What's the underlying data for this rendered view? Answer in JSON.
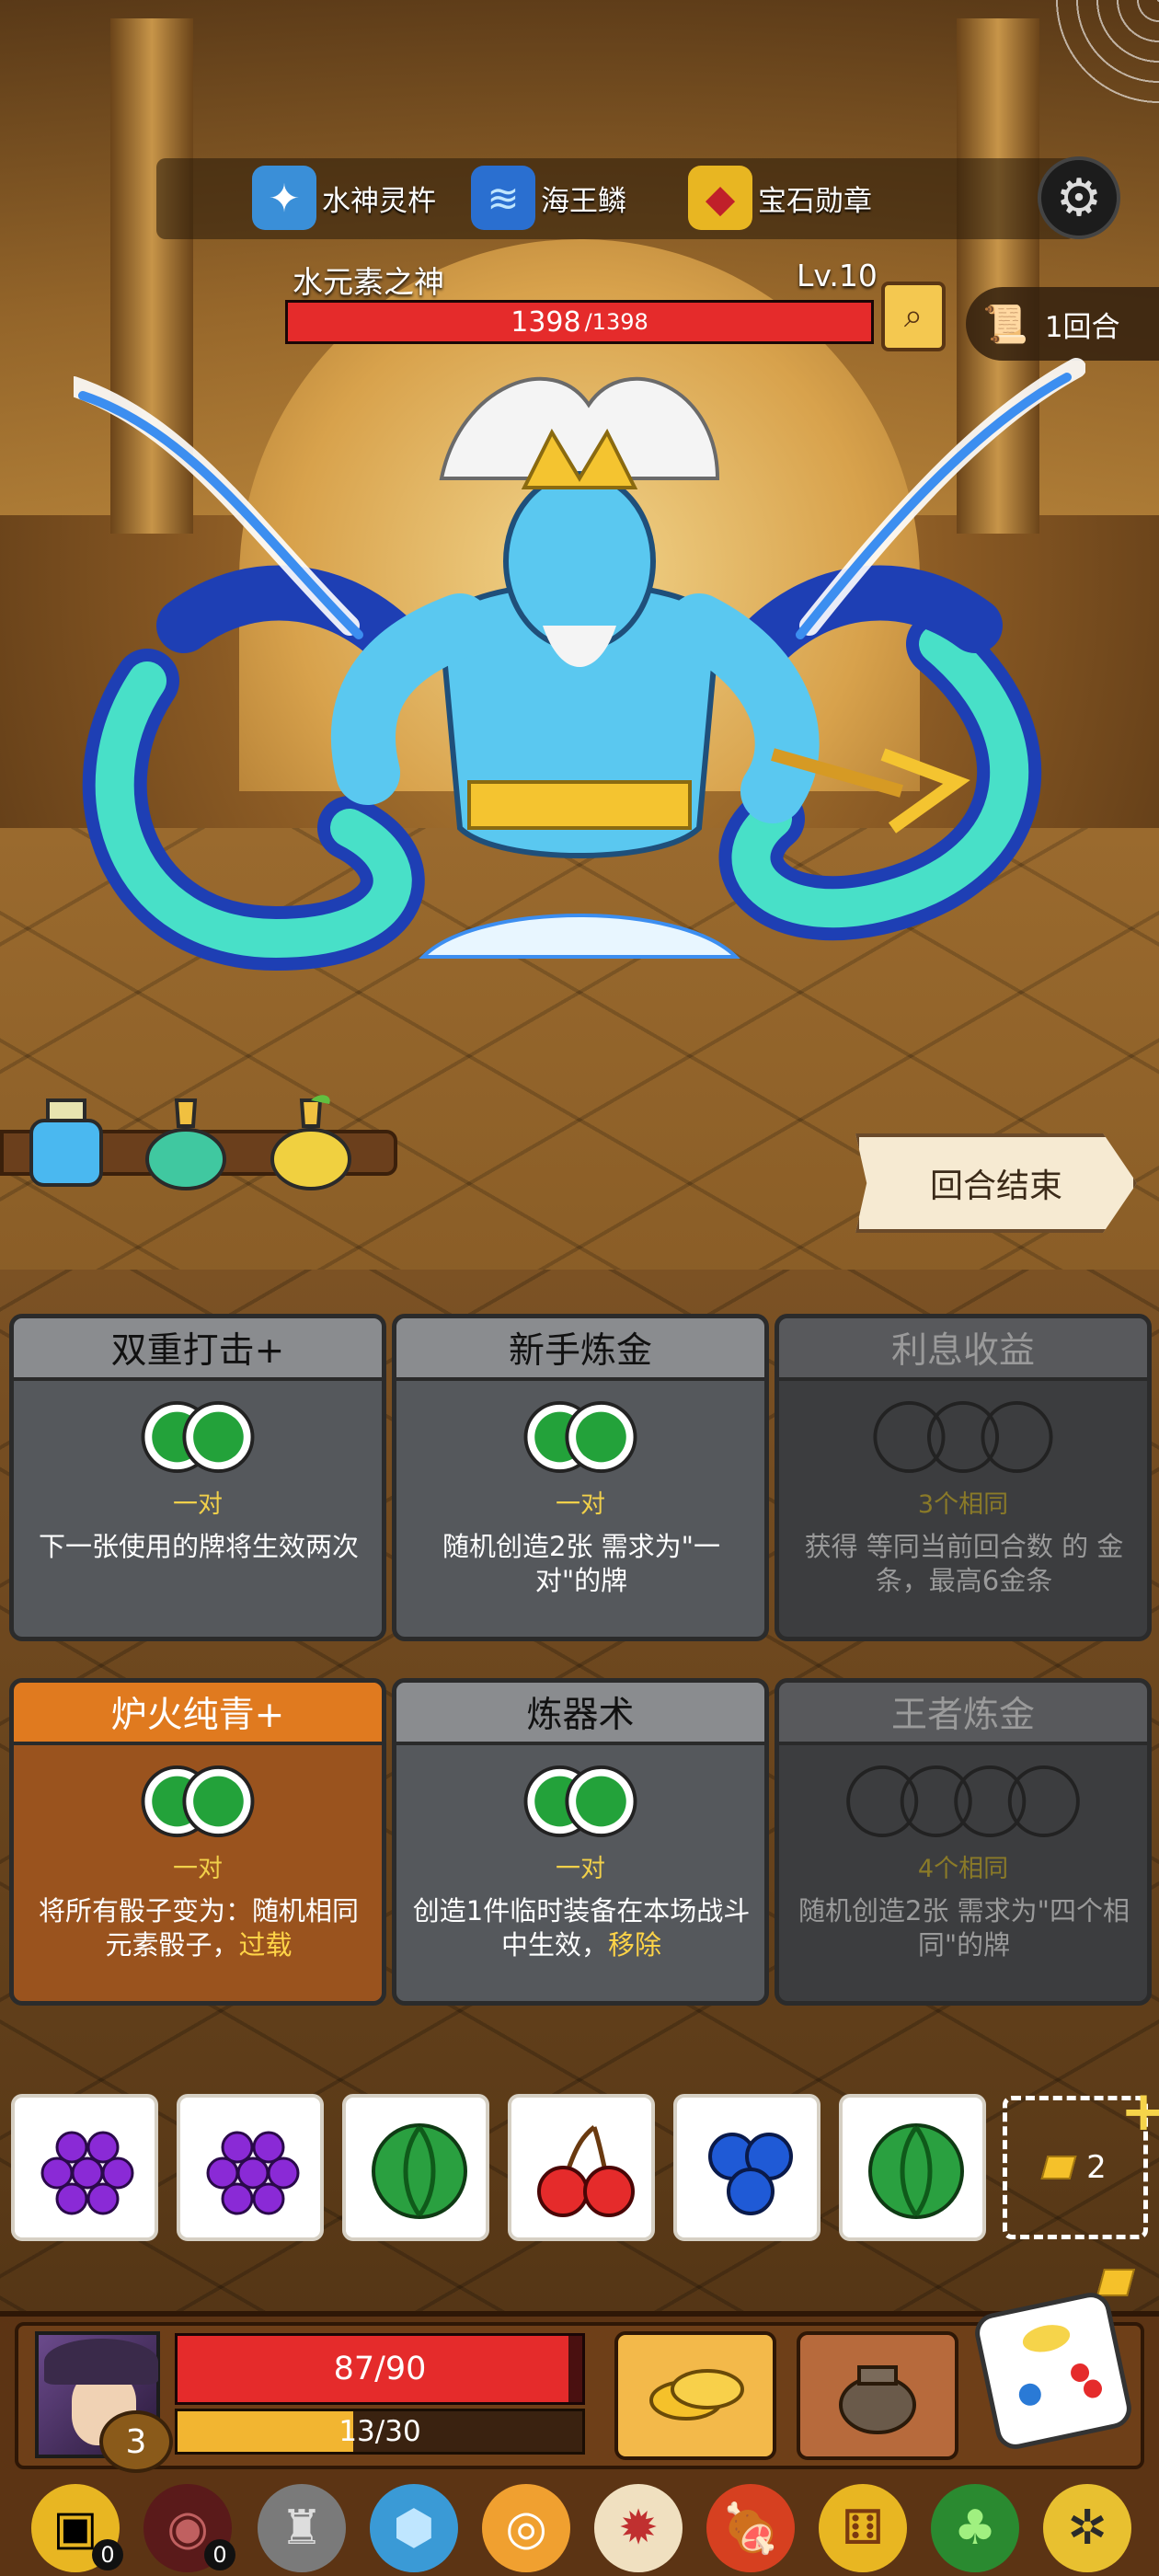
{
  "relics": [
    {
      "icon": "water-god-pestle-icon",
      "label": "水神灵杵"
    },
    {
      "icon": "sea-king-scale-icon",
      "label": "海王鳞"
    },
    {
      "icon": "gem-medal-icon",
      "label": "宝石勋章"
    }
  ],
  "boss": {
    "name": "水元素之神",
    "level": "Lv.10",
    "hp_current": "1398",
    "hp_max": "/1398",
    "hp_fraction": 1.0
  },
  "turn": {
    "label": "1回合",
    "icon": "scroll-icon"
  },
  "end_turn_label": "回合结束",
  "potions": [
    "blue-potion-icon",
    "green-potion-icon",
    "yellow-potion-icon"
  ],
  "cards": [
    {
      "title": "双重打击+",
      "req": "一对",
      "desc": "下一张使用的牌将生效两次",
      "dice": 2,
      "state": "active"
    },
    {
      "title": "新手炼金",
      "req": "一对",
      "desc": "随机创造2张 需求为\"一对\"的牌",
      "dice": 2,
      "state": "active"
    },
    {
      "title": "利息收益",
      "req": "3个相同",
      "desc": "获得 等同当前回合数 的 金条，最高6金条",
      "dice": 3,
      "state": "disabled"
    },
    {
      "title": "炉火纯青+",
      "req": "一对",
      "desc_pre": "将所有骰子变为：随机相同元素骰子，",
      "desc_hl": "过载",
      "dice": 2,
      "state": "highlight"
    },
    {
      "title": "炼器术",
      "req": "一对",
      "desc_pre": "创造1件临时装备在本场战斗中生效，",
      "desc_hl": "移除",
      "dice": 2,
      "state": "active"
    },
    {
      "title": "王者炼金",
      "req": "4个相同",
      "desc": "随机创造2张 需求为\"四个相同\"的牌",
      "dice": 4,
      "state": "disabled"
    }
  ],
  "dice_tray": [
    "grape",
    "grape",
    "watermelon",
    "cherry",
    "blueberry",
    "watermelon"
  ],
  "gold_slot": {
    "count": "2",
    "plus": "+"
  },
  "player": {
    "level": "3",
    "hp_text": "87/90",
    "hp_fraction": 0.967,
    "xp_text": "13/30",
    "xp_fraction": 0.433
  },
  "items": [
    {
      "icon": "treasure-chest-icon",
      "badge": "0"
    },
    {
      "icon": "button-coin-icon",
      "badge": "0"
    },
    {
      "icon": "stone-tower-icon",
      "badge": ""
    },
    {
      "icon": "blue-shield-icon",
      "badge": ""
    },
    {
      "icon": "golden-ring-icon",
      "badge": ""
    },
    {
      "icon": "spiky-die-icon",
      "badge": ""
    },
    {
      "icon": "roast-meat-icon",
      "badge": ""
    },
    {
      "icon": "gold-dice-icon",
      "badge": ""
    },
    {
      "icon": "clover-icon",
      "badge": ""
    },
    {
      "icon": "ladybug-icon",
      "badge": ""
    }
  ],
  "colors": {
    "hp": "#e52b2b",
    "xp": "#f2b531",
    "card_orange": "#e07a1f",
    "highlight_text": "#ffd447"
  }
}
